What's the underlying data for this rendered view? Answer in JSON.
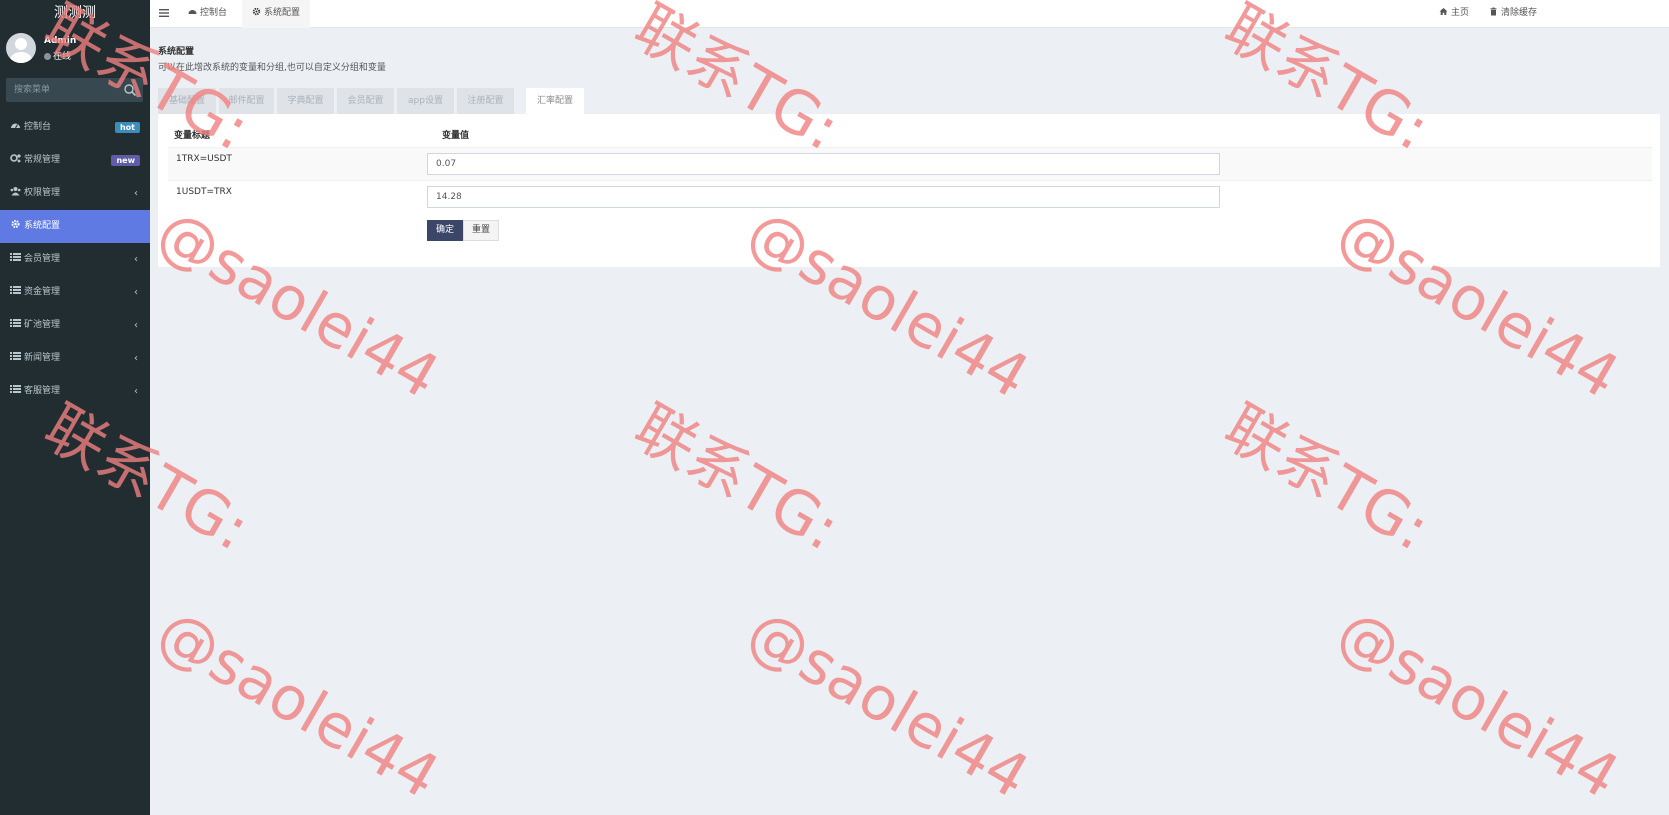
{
  "sidebar": {
    "brand": "测测测",
    "user": {
      "name": "Admin",
      "status": "在线"
    },
    "search_placeholder": "搜索菜单",
    "menu": [
      {
        "label": "控制台",
        "badge": "hot",
        "icon": "dashboard-icon"
      },
      {
        "label": "常规管理",
        "badge": "new",
        "icon": "cogs-icon"
      },
      {
        "label": "权限管理",
        "chevron": "‹",
        "icon": "group-icon"
      },
      {
        "label": "系统配置",
        "active": true,
        "icon": "gear-icon"
      },
      {
        "label": "会员管理",
        "chevron": "‹",
        "icon": "list-icon"
      },
      {
        "label": "资金管理",
        "chevron": "‹",
        "icon": "list-icon"
      },
      {
        "label": "矿池管理",
        "chevron": "‹",
        "icon": "list-icon"
      },
      {
        "label": "新闻管理",
        "chevron": "‹",
        "icon": "list-icon"
      },
      {
        "label": "客服管理",
        "chevron": "‹",
        "icon": "list-icon"
      }
    ]
  },
  "topbar": {
    "tabs": [
      {
        "label": "控制台",
        "icon": "dashboard-icon"
      },
      {
        "label": "系统配置",
        "icon": "gear-icon",
        "active": true
      }
    ],
    "links": [
      {
        "label": "主页",
        "icon": "home-icon"
      },
      {
        "label": "清除缓存",
        "icon": "trash-icon"
      }
    ]
  },
  "content": {
    "title": "系统配置",
    "description": "可以在此增改系统的变量和分组,也可以自定义分组和变量",
    "config_tabs": [
      "基础配置",
      "邮件配置",
      "字典配置",
      "会员配置",
      "app设置",
      "注册配置",
      "汇率配置"
    ],
    "active_tab_index": 6,
    "table": {
      "headers": [
        "变量标题",
        "变量值"
      ],
      "rows": [
        {
          "label": "1TRX=USDT",
          "value": "0.07"
        },
        {
          "label": "1USDT=TRX",
          "value": "14.28"
        }
      ]
    },
    "buttons": {
      "confirm": "确定",
      "reset": "重置"
    }
  },
  "watermark": {
    "text_cn": "联系TG:",
    "text_handle": "@saolei44",
    "color": "#f08080"
  },
  "colors": {
    "sidebar_bg": "#222d32",
    "sidebar_active": "#5f7be3",
    "primary_button": "#3b4668",
    "badge_hot": "#3c8dbc",
    "badge_new": "#605ca8"
  }
}
